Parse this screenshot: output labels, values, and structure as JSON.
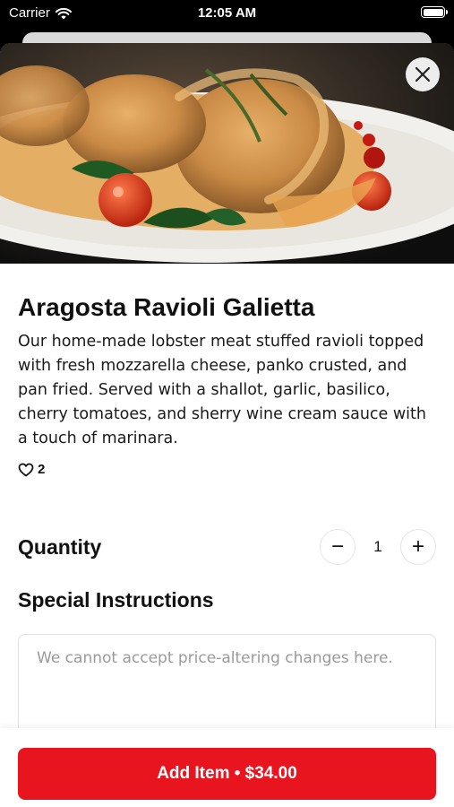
{
  "status_bar": {
    "carrier": "Carrier",
    "time": "12:05 AM"
  },
  "item": {
    "title": "Aragosta Ravioli Galietta",
    "description": "Our home-made lobster meat stuffed ravioli topped with fresh mozzarella cheese, panko crusted, and pan fried. Served with a shallot, garlic, basilico, cherry tomatoes, and sherry wine cream sauce with a touch of marinara.",
    "likes": "2"
  },
  "quantity": {
    "label": "Quantity",
    "value": "1",
    "minus": "−",
    "plus": "+"
  },
  "instructions": {
    "label": "Special Instructions",
    "placeholder": "We cannot accept price-altering changes here."
  },
  "footer": {
    "add_button_label": "Add Item • $34.00"
  },
  "colors": {
    "accent": "#e8141e"
  },
  "icons": {
    "close": "close-icon",
    "heart": "heart-icon",
    "wifi": "wifi-icon",
    "battery": "battery-icon"
  }
}
